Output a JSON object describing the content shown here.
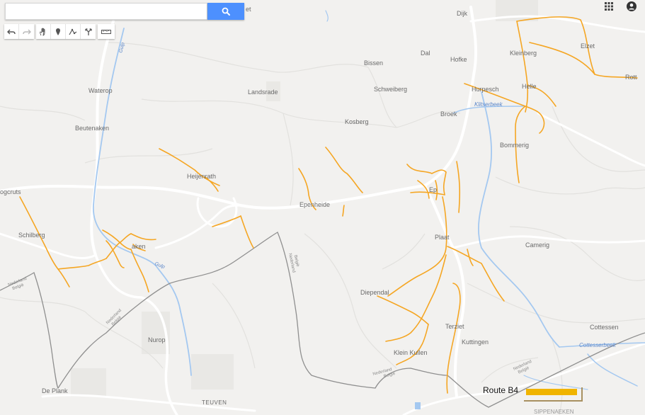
{
  "search": {
    "value": "",
    "placeholder": ""
  },
  "toolbar": {
    "tools": [
      "undo-icon",
      "redo-icon",
      "hand-icon",
      "marker-icon",
      "polyline-icon",
      "directions-icon",
      "ruler-icon"
    ]
  },
  "top_right": {
    "icons": [
      "apps-grid-icon",
      "account-icon"
    ]
  },
  "colors": {
    "route": "#f5a623",
    "legend_swatch": "#f0b400",
    "water": "#a4c8f0",
    "border": "#8a8a8a",
    "road": "#ffffff",
    "background": "#f2f1ef",
    "search_button": "#4d90fe"
  },
  "places": {
    "dijk": "Dijk",
    "dal": "Dal",
    "hofke": "Hofke",
    "kleinberg": "Kleinberg",
    "elzet": "Elzet",
    "rott": "Rott",
    "waterop": "Waterop",
    "landsrade": "Landsrade",
    "bissen": "Bissen",
    "schweiberg": "Schweiberg",
    "hurpesch": "Hurpesch",
    "helle": "Helle",
    "beutenaken": "Beutenaken",
    "broek": "Broek",
    "kosberg": "Kosberg",
    "bommerig": "Bommerig",
    "heijenrath": "Heijenrath",
    "epenheide": "Epenheide",
    "schilberg": "Schilberg",
    "plaat": "Plaat",
    "camerig": "Camerig",
    "diependal": "Diependal",
    "terziet": "Terziet",
    "kuttingen": "Kuttingen",
    "klein_kullen": "Klein Kullen",
    "cottessen": "Cottessen",
    "nurop": "Nurop",
    "de_plank": "De Plank",
    "teuven": "TEUVEN",
    "left_edge": "ogcruts",
    "ep_fragment": "Ep",
    "aken_fragment": "aken",
    "top_fragment": "et",
    "bottom_right_fragment": "SIPPENAEKEN"
  },
  "water_labels": {
    "klitserbeek": "Klitserbeek",
    "gulp_north": "Gulp",
    "gulp_south": "Gulp",
    "cottesserbeek": "Cottesserbeek"
  },
  "border_labels": {
    "b1": [
      "Nederland",
      "België"
    ],
    "b2": [
      "Nederland",
      "België"
    ],
    "b3": [
      "Nederland",
      "België"
    ],
    "b4": [
      "Nederland",
      "België"
    ],
    "b5": [
      "Nederland",
      "België"
    ]
  },
  "legend": {
    "label": "Route B4"
  }
}
